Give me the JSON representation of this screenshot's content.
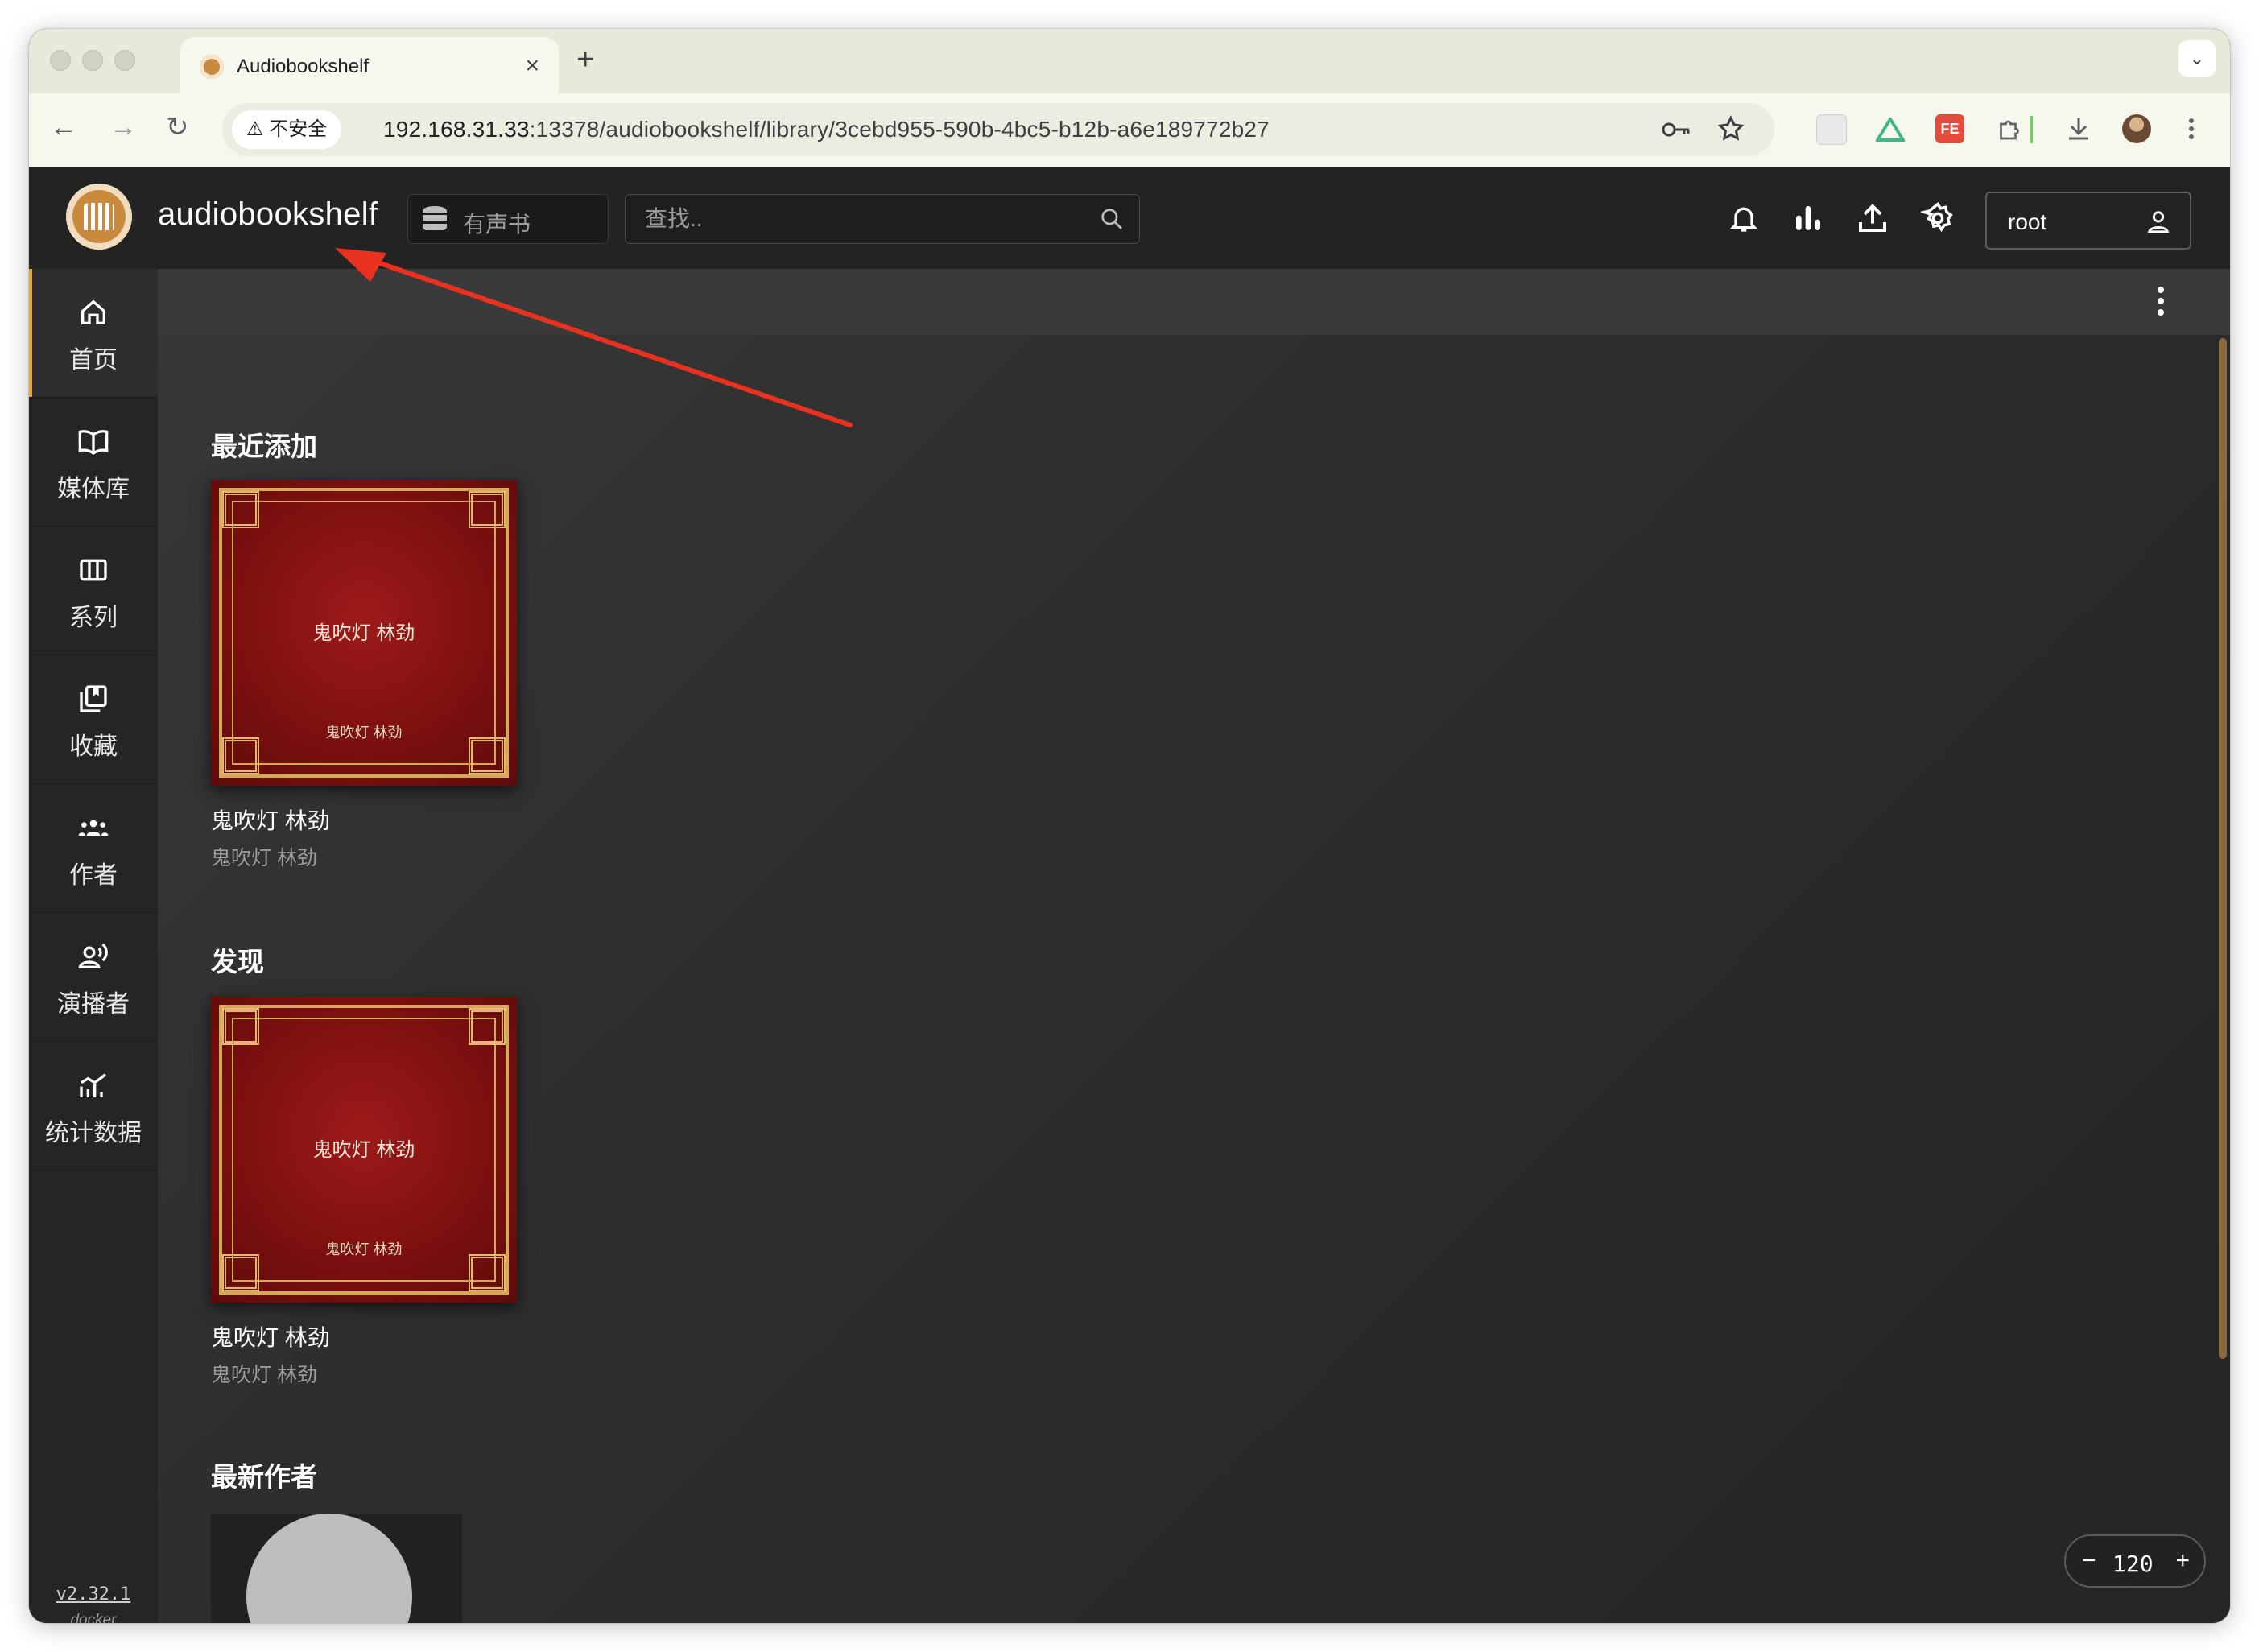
{
  "browser": {
    "tab_title": "Audiobookshelf",
    "tab_close": "×",
    "new_tab": "+",
    "tab_menu": "⌄",
    "back": "←",
    "forward": "→",
    "reload": "↻",
    "security_label": "⚠ 不安全",
    "url_host": "192.168.31.33",
    "url_path": ":13378/audiobookshelf/library/3cebd955-590b-4bc5-b12b-a6e189772b27",
    "toolbar_icons": [
      "key-icon",
      "star-icon",
      "extension-react-icon",
      "extension-vue-icon",
      "extension-fe-icon",
      "puzzle-icon",
      "download-icon",
      "profile-avatar",
      "more-vert-icon"
    ]
  },
  "app": {
    "brand": "audiobookshelf",
    "library": "有声书",
    "search_placeholder": "查找..",
    "user": "root",
    "header_icons": [
      "bell-icon",
      "stats-bars-icon",
      "upload-icon",
      "settings-gear-icon"
    ]
  },
  "sidebar": {
    "items": [
      {
        "label": "首页",
        "icon": "home-icon",
        "active": true
      },
      {
        "label": "媒体库",
        "icon": "book-open-icon",
        "active": false
      },
      {
        "label": "系列",
        "icon": "columns-icon",
        "active": false
      },
      {
        "label": "收藏",
        "icon": "collection-icon",
        "active": false
      },
      {
        "label": "作者",
        "icon": "authors-icon",
        "active": false
      },
      {
        "label": "演播者",
        "icon": "narrator-icon",
        "active": false
      },
      {
        "label": "统计数据",
        "icon": "stats-chart-icon",
        "active": false
      }
    ],
    "version": "v2.32.1",
    "platform": "docker"
  },
  "shelves": [
    {
      "title": "最近添加",
      "book": {
        "title": "鬼吹灯 林劲",
        "author": "鬼吹灯 林劲",
        "cover_title": "鬼吹灯 林劲",
        "cover_author": "鬼吹灯 林劲"
      }
    },
    {
      "title": "发现",
      "book": {
        "title": "鬼吹灯 林劲",
        "author": "鬼吹灯 林劲",
        "cover_title": "鬼吹灯 林劲",
        "cover_author": "鬼吹灯 林劲"
      }
    },
    {
      "title": "最新作者"
    }
  ],
  "zoom": {
    "minus": "−",
    "value": "120",
    "plus": "+"
  },
  "colors": {
    "accent": "#e0a93a",
    "annotation_arrow": "#e8321f",
    "cover_red": "#8b1414",
    "cover_gold": "#d6a85a"
  }
}
